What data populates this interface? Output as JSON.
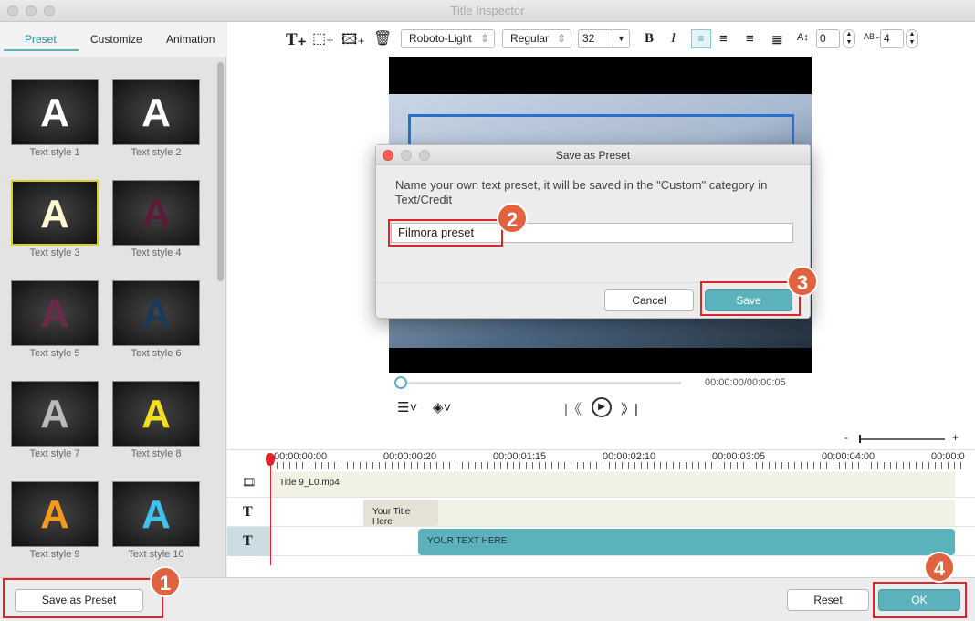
{
  "window": {
    "title": "Title Inspector"
  },
  "tabs": [
    {
      "label": "Preset",
      "active": true
    },
    {
      "label": "Customize"
    },
    {
      "label": "Animation"
    }
  ],
  "presets": [
    {
      "label": "Text style 1",
      "color": "#ffffff"
    },
    {
      "label": "Text style 2",
      "color": "#ffffff"
    },
    {
      "label": "Text style 3",
      "color": "#fff7d0",
      "selected": true
    },
    {
      "label": "Text style 4",
      "color": "#5a1a3a"
    },
    {
      "label": "Text style 5",
      "color": "#6a2a4a"
    },
    {
      "label": "Text style 6",
      "color": "#1a3a5a"
    },
    {
      "label": "Text style 7",
      "color": "#bbbbbb"
    },
    {
      "label": "Text style 8",
      "color": "#f4e020"
    },
    {
      "label": "Text style 9",
      "color": "#f39a1e"
    },
    {
      "label": "Text style 10",
      "color": "#3ec3f0"
    }
  ],
  "preset_glyph": "A",
  "toolbar": {
    "font": "Roboto-Light",
    "weight": "Regular",
    "size": "32",
    "line_spacing": "0",
    "char_spacing": "4"
  },
  "player": {
    "time": "00:00:00/00:00:05"
  },
  "dialog": {
    "title": "Save as Preset",
    "message": "Name your own text preset, it will be saved in the \"Custom\" category in Text/Credit",
    "input_value": "Filmora preset",
    "cancel": "Cancel",
    "save": "Save"
  },
  "timeline": {
    "ticks": [
      "00:00:00:00",
      "00:00:00:20",
      "00:00:01:15",
      "00:00:02:10",
      "00:00:03:05",
      "00:00:04:00",
      "00:00:0"
    ],
    "tracks": [
      {
        "clip": "Title 9_L0.mp4"
      },
      {
        "clip": "Your Title Here"
      },
      {
        "clip": "YOUR TEXT HERE"
      }
    ]
  },
  "buttons": {
    "save_preset": "Save as Preset",
    "reset": "Reset",
    "ok": "OK"
  },
  "annotations": [
    "1",
    "2",
    "3",
    "4"
  ],
  "accent": "#5bb2bc"
}
